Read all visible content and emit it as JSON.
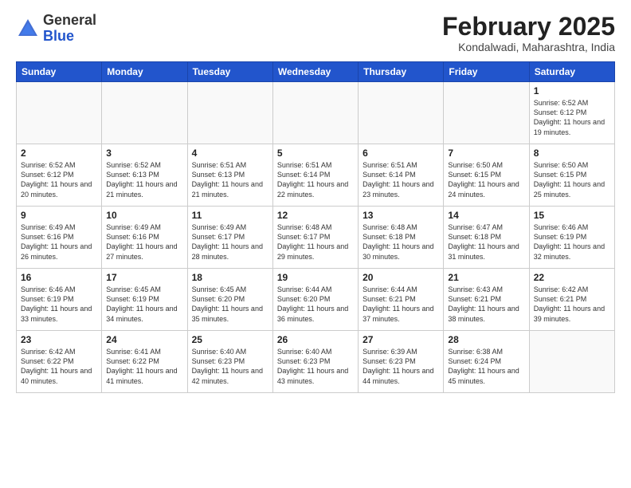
{
  "header": {
    "logo_general": "General",
    "logo_blue": "Blue",
    "month_title": "February 2025",
    "location": "Kondalwadi, Maharashtra, India"
  },
  "weekdays": [
    "Sunday",
    "Monday",
    "Tuesday",
    "Wednesday",
    "Thursday",
    "Friday",
    "Saturday"
  ],
  "weeks": [
    [
      {
        "day": "",
        "info": ""
      },
      {
        "day": "",
        "info": ""
      },
      {
        "day": "",
        "info": ""
      },
      {
        "day": "",
        "info": ""
      },
      {
        "day": "",
        "info": ""
      },
      {
        "day": "",
        "info": ""
      },
      {
        "day": "1",
        "info": "Sunrise: 6:52 AM\nSunset: 6:12 PM\nDaylight: 11 hours\nand 19 minutes."
      }
    ],
    [
      {
        "day": "2",
        "info": "Sunrise: 6:52 AM\nSunset: 6:12 PM\nDaylight: 11 hours\nand 20 minutes."
      },
      {
        "day": "3",
        "info": "Sunrise: 6:52 AM\nSunset: 6:13 PM\nDaylight: 11 hours\nand 21 minutes."
      },
      {
        "day": "4",
        "info": "Sunrise: 6:51 AM\nSunset: 6:13 PM\nDaylight: 11 hours\nand 21 minutes."
      },
      {
        "day": "5",
        "info": "Sunrise: 6:51 AM\nSunset: 6:14 PM\nDaylight: 11 hours\nand 22 minutes."
      },
      {
        "day": "6",
        "info": "Sunrise: 6:51 AM\nSunset: 6:14 PM\nDaylight: 11 hours\nand 23 minutes."
      },
      {
        "day": "7",
        "info": "Sunrise: 6:50 AM\nSunset: 6:15 PM\nDaylight: 11 hours\nand 24 minutes."
      },
      {
        "day": "8",
        "info": "Sunrise: 6:50 AM\nSunset: 6:15 PM\nDaylight: 11 hours\nand 25 minutes."
      }
    ],
    [
      {
        "day": "9",
        "info": "Sunrise: 6:49 AM\nSunset: 6:16 PM\nDaylight: 11 hours\nand 26 minutes."
      },
      {
        "day": "10",
        "info": "Sunrise: 6:49 AM\nSunset: 6:16 PM\nDaylight: 11 hours\nand 27 minutes."
      },
      {
        "day": "11",
        "info": "Sunrise: 6:49 AM\nSunset: 6:17 PM\nDaylight: 11 hours\nand 28 minutes."
      },
      {
        "day": "12",
        "info": "Sunrise: 6:48 AM\nSunset: 6:17 PM\nDaylight: 11 hours\nand 29 minutes."
      },
      {
        "day": "13",
        "info": "Sunrise: 6:48 AM\nSunset: 6:18 PM\nDaylight: 11 hours\nand 30 minutes."
      },
      {
        "day": "14",
        "info": "Sunrise: 6:47 AM\nSunset: 6:18 PM\nDaylight: 11 hours\nand 31 minutes."
      },
      {
        "day": "15",
        "info": "Sunrise: 6:46 AM\nSunset: 6:19 PM\nDaylight: 11 hours\nand 32 minutes."
      }
    ],
    [
      {
        "day": "16",
        "info": "Sunrise: 6:46 AM\nSunset: 6:19 PM\nDaylight: 11 hours\nand 33 minutes."
      },
      {
        "day": "17",
        "info": "Sunrise: 6:45 AM\nSunset: 6:19 PM\nDaylight: 11 hours\nand 34 minutes."
      },
      {
        "day": "18",
        "info": "Sunrise: 6:45 AM\nSunset: 6:20 PM\nDaylight: 11 hours\nand 35 minutes."
      },
      {
        "day": "19",
        "info": "Sunrise: 6:44 AM\nSunset: 6:20 PM\nDaylight: 11 hours\nand 36 minutes."
      },
      {
        "day": "20",
        "info": "Sunrise: 6:44 AM\nSunset: 6:21 PM\nDaylight: 11 hours\nand 37 minutes."
      },
      {
        "day": "21",
        "info": "Sunrise: 6:43 AM\nSunset: 6:21 PM\nDaylight: 11 hours\nand 38 minutes."
      },
      {
        "day": "22",
        "info": "Sunrise: 6:42 AM\nSunset: 6:21 PM\nDaylight: 11 hours\nand 39 minutes."
      }
    ],
    [
      {
        "day": "23",
        "info": "Sunrise: 6:42 AM\nSunset: 6:22 PM\nDaylight: 11 hours\nand 40 minutes."
      },
      {
        "day": "24",
        "info": "Sunrise: 6:41 AM\nSunset: 6:22 PM\nDaylight: 11 hours\nand 41 minutes."
      },
      {
        "day": "25",
        "info": "Sunrise: 6:40 AM\nSunset: 6:23 PM\nDaylight: 11 hours\nand 42 minutes."
      },
      {
        "day": "26",
        "info": "Sunrise: 6:40 AM\nSunset: 6:23 PM\nDaylight: 11 hours\nand 43 minutes."
      },
      {
        "day": "27",
        "info": "Sunrise: 6:39 AM\nSunset: 6:23 PM\nDaylight: 11 hours\nand 44 minutes."
      },
      {
        "day": "28",
        "info": "Sunrise: 6:38 AM\nSunset: 6:24 PM\nDaylight: 11 hours\nand 45 minutes."
      },
      {
        "day": "",
        "info": ""
      }
    ]
  ]
}
